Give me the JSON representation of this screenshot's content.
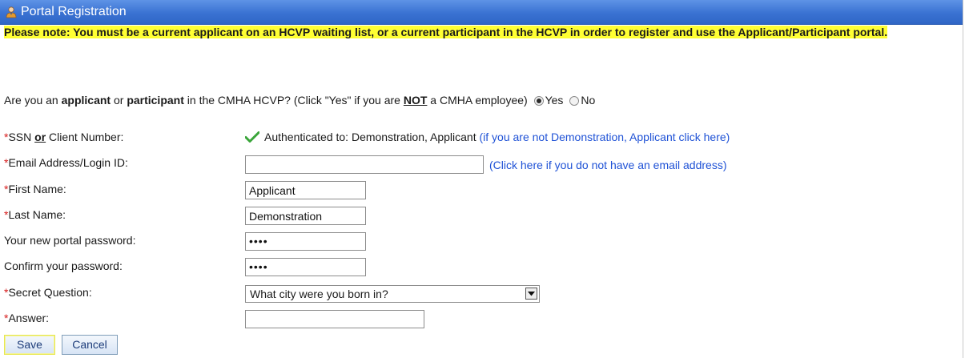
{
  "header": {
    "title": "Portal Registration",
    "icon": "user-icon"
  },
  "note": "Please note: You must be a current applicant on an HCVP waiting list, or a current participant in the HCVP in order to register and use the Applicant/Participant portal.",
  "question": {
    "part1": "Are you an ",
    "bold1": "applicant",
    "part2": " or ",
    "bold2": "participant",
    "part3": " in the CMHA HCVP? (Click \"Yes\" if you are ",
    "not": "NOT",
    "part4": " a CMHA employee)",
    "yes_label": "Yes",
    "no_label": "No",
    "selected": "Yes"
  },
  "form": {
    "required_mark": "*",
    "ssn": {
      "label_a": "SSN ",
      "label_or": "or",
      "label_b": " Client Number:"
    },
    "auth": {
      "text": "Authenticated to: Demonstration, Applicant ",
      "link": "(if you are not Demonstration, Applicant click here)"
    },
    "email": {
      "label": "Email Address/Login ID:",
      "value": "",
      "link": "(Click here if you do not have an email address)"
    },
    "first_name": {
      "label": "First Name:",
      "value": "Applicant"
    },
    "last_name": {
      "label": "Last Name:",
      "value": "Demonstration"
    },
    "password": {
      "label": "Your new portal password:",
      "value": "••••"
    },
    "confirm": {
      "label": "Confirm your password:",
      "value": "••••"
    },
    "secret_question": {
      "label": "Secret Question:",
      "value": "What city were you born in?"
    },
    "answer": {
      "label": "Answer:",
      "value": ""
    }
  },
  "buttons": {
    "save": "Save",
    "cancel": "Cancel"
  },
  "colors": {
    "header": "#3a72d2",
    "highlight": "#ffff33",
    "required": "#d61a1a",
    "link": "#1f52d6"
  }
}
